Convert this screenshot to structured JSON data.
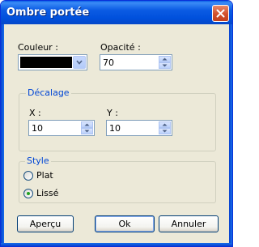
{
  "window": {
    "title": "Ombre portée"
  },
  "icons": {
    "close": "close-icon",
    "dropdown": "chevron-down-icon",
    "up": "spin-up-icon",
    "down": "spin-down-icon"
  },
  "colors": {
    "shadow_color": "#000000",
    "title_bar": "#0054e3",
    "group_legend": "#0046d5",
    "radio_selected": "#21a121"
  },
  "couleur": {
    "label": "Couleur :"
  },
  "opacite": {
    "label": "Opacité :",
    "value": "70"
  },
  "decalage": {
    "legend": "Décalage",
    "x": {
      "label": "X :",
      "value": "10"
    },
    "y": {
      "label": "Y :",
      "value": "10"
    }
  },
  "style": {
    "legend": "Style",
    "options": [
      {
        "label": "Plat",
        "selected": false
      },
      {
        "label": "Lissé",
        "selected": true
      }
    ]
  },
  "buttons": {
    "preview": "Aperçu",
    "ok": "Ok",
    "cancel": "Annuler"
  }
}
